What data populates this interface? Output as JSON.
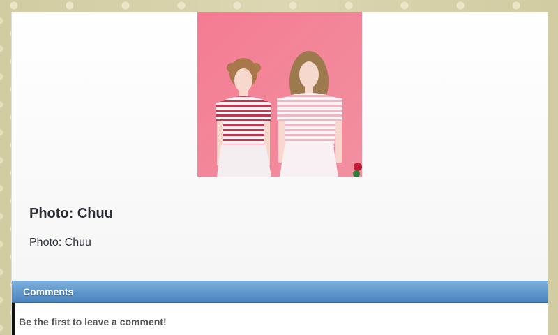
{
  "article": {
    "photo_alt": "Photo: Chuu",
    "caption_title": "Photo: Chuu",
    "caption_text": "Photo: Chuu"
  },
  "comments": {
    "header_label": "Comments",
    "empty_message": "Be the first to leave a comment!"
  },
  "colors": {
    "background": "#d6d0a8",
    "comments_header": "#5a92cb",
    "photo_background": "#f37f94"
  }
}
